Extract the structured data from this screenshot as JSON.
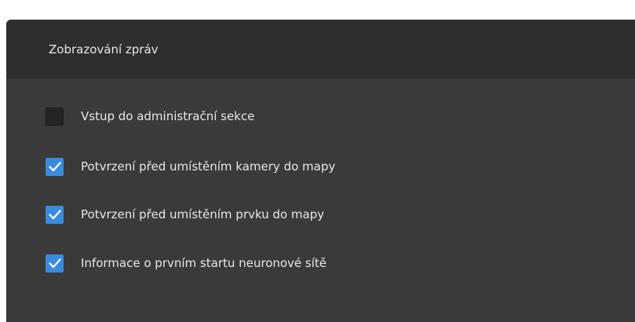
{
  "section": {
    "title": "Zobrazování zpráv"
  },
  "options": [
    {
      "label": "Vstup do administrační sekce",
      "checked": false
    },
    {
      "label": "Potvrzení před umístěním kamery do mapy",
      "checked": true
    },
    {
      "label": "Potvrzení před umístěním prvku do mapy",
      "checked": true
    },
    {
      "label": "Informace o prvním startu neuronové sítě",
      "checked": true
    }
  ],
  "colors": {
    "accent": "#3a8be0",
    "panel_bg": "#3a3a3a",
    "header_bg": "#2e2e2e"
  }
}
